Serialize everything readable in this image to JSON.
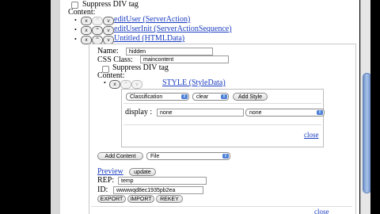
{
  "tree": {
    "suppress_div_top": "Suppress DIV tag",
    "content_label": "Content:",
    "nodes": [
      {
        "label": "editUser (ServerAction)",
        "buttons": [
          "x",
          "^",
          "v"
        ]
      },
      {
        "label": "editUserInit (ServerActionSequence)",
        "buttons": [
          "x",
          "^",
          "v"
        ]
      },
      {
        "label": "Untitled (HTMLData)",
        "buttons": [
          "x",
          "^",
          "v"
        ]
      }
    ]
  },
  "html_data": {
    "name_label": "Name:",
    "name_value": "hidden",
    "css_label": "CSS Class:",
    "css_value": "maincontent",
    "suppress_div": "Suppress DIV tag",
    "content_label": "Content:",
    "style_node": {
      "label": "STYLE (StyleData)",
      "buttons": [
        "x",
        "^",
        "v"
      ]
    }
  },
  "style_editor": {
    "classification_select": "Classification",
    "clear_select": "clear",
    "add_style_button": "Add Style",
    "property_label": "display :",
    "property_value": "none",
    "property_select": "none",
    "close_link": "close"
  },
  "bottom": {
    "add_content_button": "Add Content",
    "file_select": "File",
    "preview_link": "Preview",
    "update_button": "update",
    "rep_label": "REP:",
    "rep_value": "temp",
    "id_label": "ID:",
    "id_value": "wwwwqd8ec1935pb2ea",
    "export_button": "EXPORT",
    "import_button": "IMPORT",
    "rekey_button": "REKEY",
    "bottom_close_link": "close"
  },
  "colors": {
    "link": "#1a3cc0",
    "accent": "#3b73c8",
    "scroll_thumb": "#6f93c9"
  }
}
